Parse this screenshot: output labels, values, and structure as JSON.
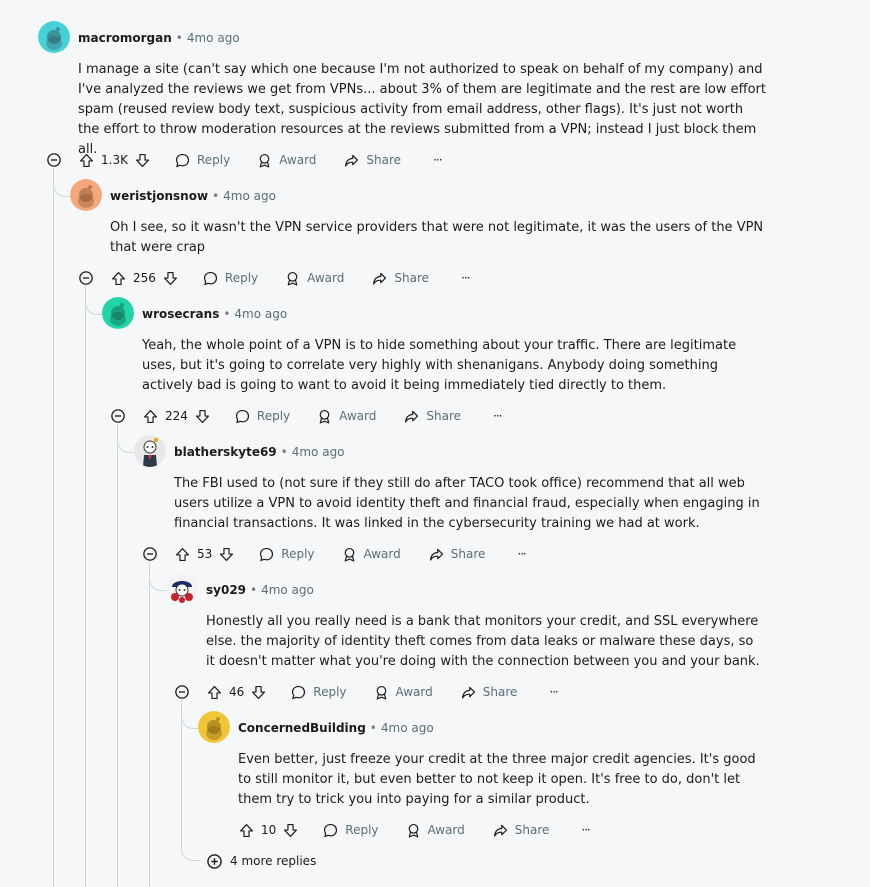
{
  "comments": [
    {
      "author": "macromorgan",
      "time": "4mo ago",
      "body": "I manage a site (can't say which one because I'm not authorized to speak on behalf of my company) and I've analyzed the reviews we get from VPNs... about 3% of them are legitimate and the rest are low effort spam (reused review body text, suspicious activity from email address, other flags). It's just not worth the effort to throw moderation resources at the reviews submitted from a VPN; instead I just block them all.",
      "votes": "1.3K",
      "avatar_color": "#46d1d8"
    },
    {
      "author": "weristjonsnow",
      "time": "4mo ago",
      "body": "Oh I see, so it wasn't the VPN service providers that were not legitimate, it was the users of the VPN that were crap",
      "votes": "256",
      "avatar_color": "#f4a87a"
    },
    {
      "author": "wrosecrans",
      "time": "4mo ago",
      "body": "Yeah, the whole point of a VPN is to hide something about your traffic. There are legitimate uses, but it's going to correlate very highly with shenanigans. Anybody doing something actively bad is going to want to avoid it being immediately tied directly to them.",
      "votes": "224",
      "avatar_color": "#21d4a7"
    },
    {
      "author": "blatherskyte69",
      "time": "4mo ago",
      "body": "The FBI used to (not sure if they still do after TACO took office) recommend that all web users utilize a VPN to avoid identity theft and financial fraud, especially when engaging in financial transactions. It was linked in the cybersecurity training we had at work.",
      "votes": "53",
      "avatar_color": "#e8e8e8"
    },
    {
      "author": "sy029",
      "time": "4mo ago",
      "body": "Honestly all you really need is a bank that monitors your credit, and SSL everywhere else. the majority of identity theft comes from data leaks or malware these days, so it doesn't matter what you're doing with the connection between you and your bank.",
      "votes": "46",
      "avatar_color": "#c8202a"
    },
    {
      "author": "ConcernedBuilding",
      "time": "4mo ago",
      "body": "Even better, just freeze your credit at the three major credit agencies. It's good to still monitor it, but even better to not keep it open. It's free to do, don't let them try to trick you into paying for a similar product.",
      "votes": "10",
      "avatar_color": "#f2c534"
    }
  ],
  "actions": {
    "reply": "Reply",
    "award": "Award",
    "share": "Share",
    "more": "···"
  },
  "more_replies": "4 more replies"
}
